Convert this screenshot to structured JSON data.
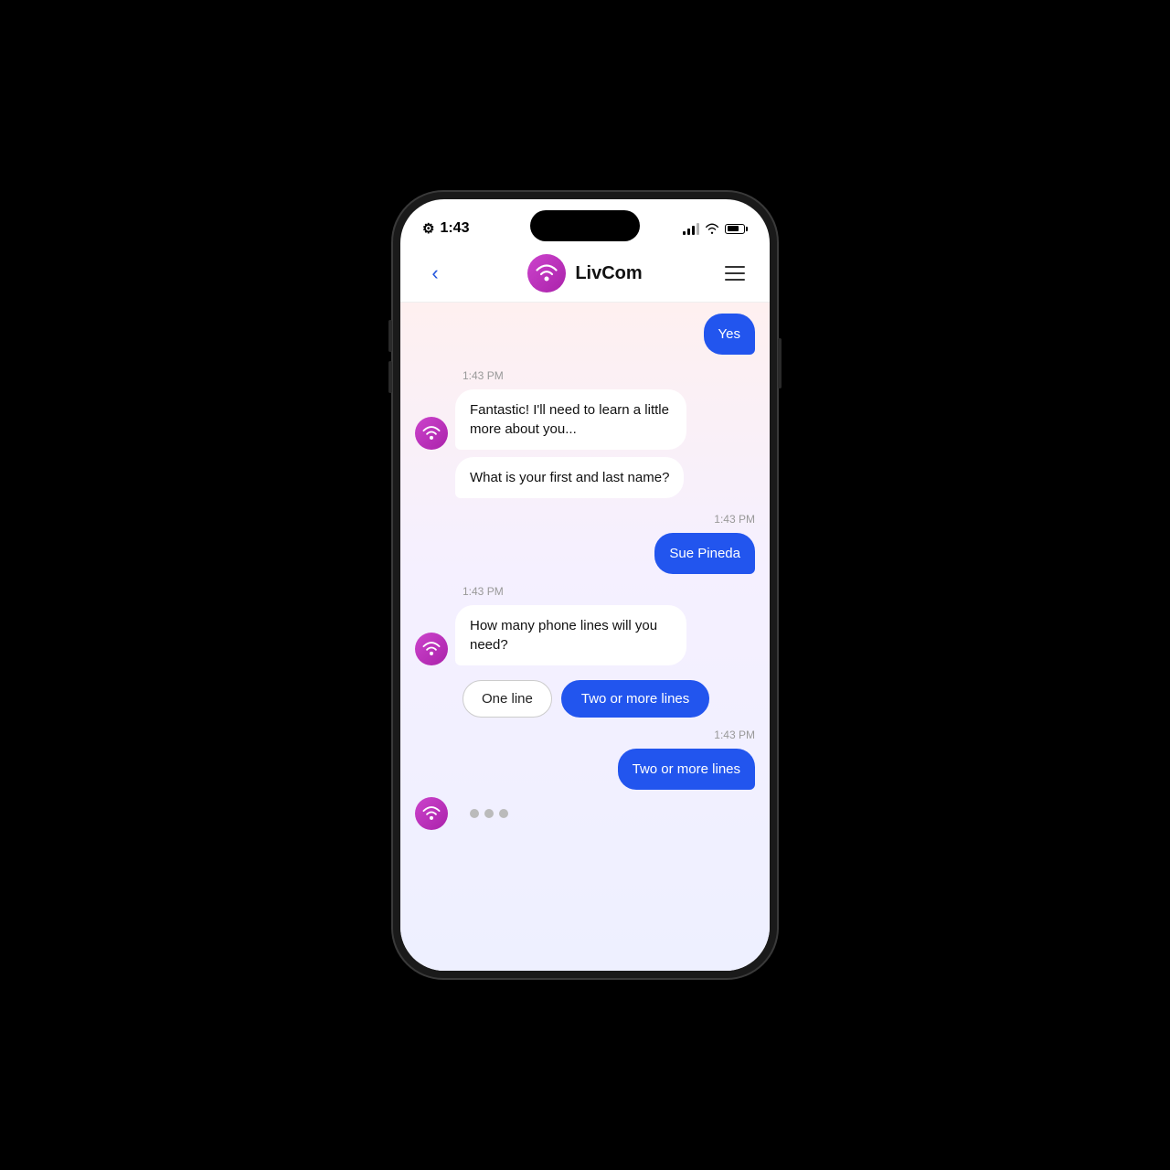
{
  "status_bar": {
    "time": "1:43",
    "gear": "⚙"
  },
  "header": {
    "back_label": "‹",
    "app_name": "LivCom",
    "menu_label": "≡"
  },
  "messages": [
    {
      "id": "yes-partial",
      "type": "user-partial",
      "text": "Yes"
    },
    {
      "id": "bot-msg-1-ts",
      "type": "timestamp-left",
      "text": "1:43 PM"
    },
    {
      "id": "bot-msg-1",
      "type": "bot",
      "text": "Fantastic! I'll need to learn a little more about you..."
    },
    {
      "id": "bot-msg-2",
      "type": "bot-no-avatar",
      "text": "What is your first and last name?"
    },
    {
      "id": "user-msg-1-ts",
      "type": "timestamp-right",
      "text": "1:43 PM"
    },
    {
      "id": "user-msg-1",
      "type": "user",
      "text": "Sue Pineda"
    },
    {
      "id": "bot-msg-3-ts",
      "type": "timestamp-left",
      "text": "1:43 PM"
    },
    {
      "id": "bot-msg-3",
      "type": "bot",
      "text": "How many phone lines will you need?"
    },
    {
      "id": "quick-replies",
      "type": "quick-replies",
      "options": [
        {
          "label": "One line",
          "style": "outline"
        },
        {
          "label": "Two or more lines",
          "style": "filled"
        }
      ]
    },
    {
      "id": "user-msg-2-ts",
      "type": "timestamp-right",
      "text": "1:43 PM"
    },
    {
      "id": "user-msg-2",
      "type": "user",
      "text": "Two or more lines"
    },
    {
      "id": "typing",
      "type": "typing"
    }
  ]
}
